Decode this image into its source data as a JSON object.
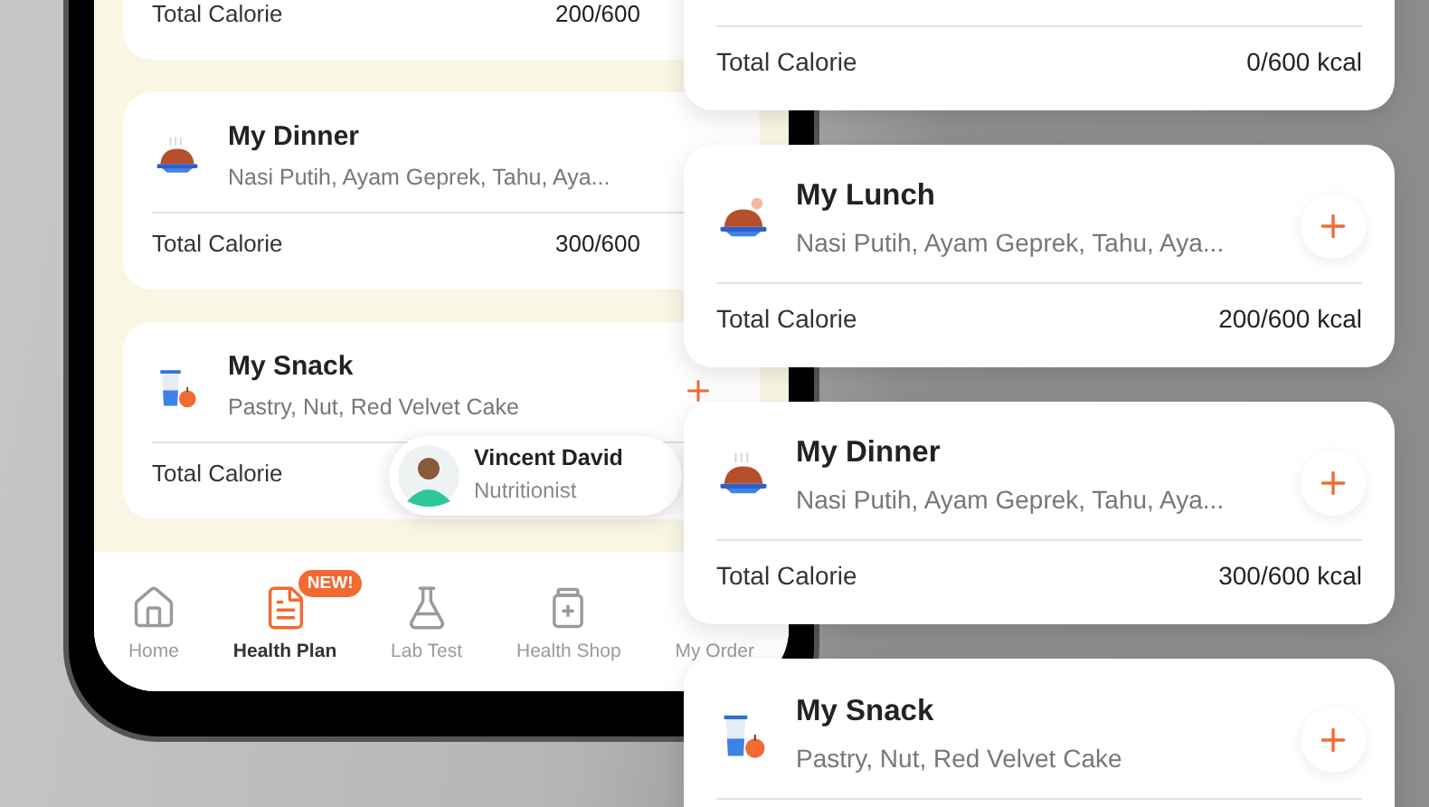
{
  "phone": {
    "meals": [
      {
        "total_label": "Total Calorie",
        "total": "200/600"
      },
      {
        "kind": "dinner",
        "title": "My Dinner",
        "items": "Nasi Putih, Ayam Geprek, Tahu, Aya...",
        "total_label": "Total Calorie",
        "total": "300/600"
      },
      {
        "kind": "snack",
        "title": "My Snack",
        "items": "Pastry, Nut, Red Velvet Cake",
        "total_label": "Total Calorie"
      }
    ],
    "nutritionist": {
      "name": "Vincent David",
      "role": "Nutritionist"
    },
    "nav": [
      {
        "kind": "home",
        "label": "Home",
        "selected": false
      },
      {
        "kind": "plan",
        "label": "Health Plan",
        "selected": true,
        "badge": "NEW!"
      },
      {
        "kind": "lab",
        "label": "Lab Test",
        "selected": false
      },
      {
        "kind": "shop",
        "label": "Health Shop",
        "selected": false
      },
      {
        "kind": "order",
        "label": "My Order",
        "selected": false
      }
    ]
  },
  "cards": [
    {
      "total_label": "Total Calorie",
      "total": "0/600 kcal"
    },
    {
      "kind": "lunch",
      "title": "My Lunch",
      "items": "Nasi Putih, Ayam Geprek, Tahu, Aya...",
      "total_label": "Total Calorie",
      "total": "200/600 kcal"
    },
    {
      "kind": "dinner",
      "title": "My Dinner",
      "items": "Nasi Putih, Ayam Geprek, Tahu, Aya...",
      "total_label": "Total Calorie",
      "total": "300/600 kcal"
    },
    {
      "kind": "snack",
      "title": "My Snack",
      "items": "Pastry, Nut, Red Velvet Cake"
    }
  ]
}
